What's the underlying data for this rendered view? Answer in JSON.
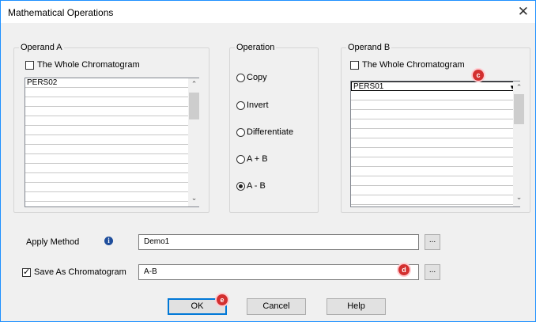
{
  "window": {
    "title": "Mathematical Operations",
    "close_glyph": "✕"
  },
  "operand_a": {
    "legend": "Operand A",
    "whole_label": "The Whole Chromatogram",
    "whole_checked": false,
    "items": [
      "PERS02",
      "",
      "",
      "",
      "",
      "",
      "",
      "",
      "",
      "",
      ""
    ]
  },
  "operation": {
    "legend": "Operation",
    "options": [
      {
        "label": "Copy",
        "selected": false
      },
      {
        "label": "Invert",
        "selected": false
      },
      {
        "label": "Differentiate",
        "selected": false
      },
      {
        "label": "A + B",
        "selected": false
      },
      {
        "label": "A - B",
        "selected": true
      }
    ]
  },
  "operand_b": {
    "legend": "Operand B",
    "whole_label": "The Whole Chromatogram",
    "whole_checked": false,
    "items": [
      "PERS01",
      "",
      "",
      "",
      "",
      "",
      "",
      "",
      "",
      "",
      ""
    ]
  },
  "apply_method": {
    "label": "Apply Method",
    "info_icon": "i",
    "value": "Demo1",
    "browse": "..."
  },
  "save_as": {
    "label": "Save As Chromatogram",
    "checked": true,
    "value": "A-B",
    "browse": "..."
  },
  "buttons": {
    "ok": "OK",
    "cancel": "Cancel",
    "help": "Help"
  },
  "callouts": {
    "c": "c",
    "d": "d",
    "e": "e"
  }
}
